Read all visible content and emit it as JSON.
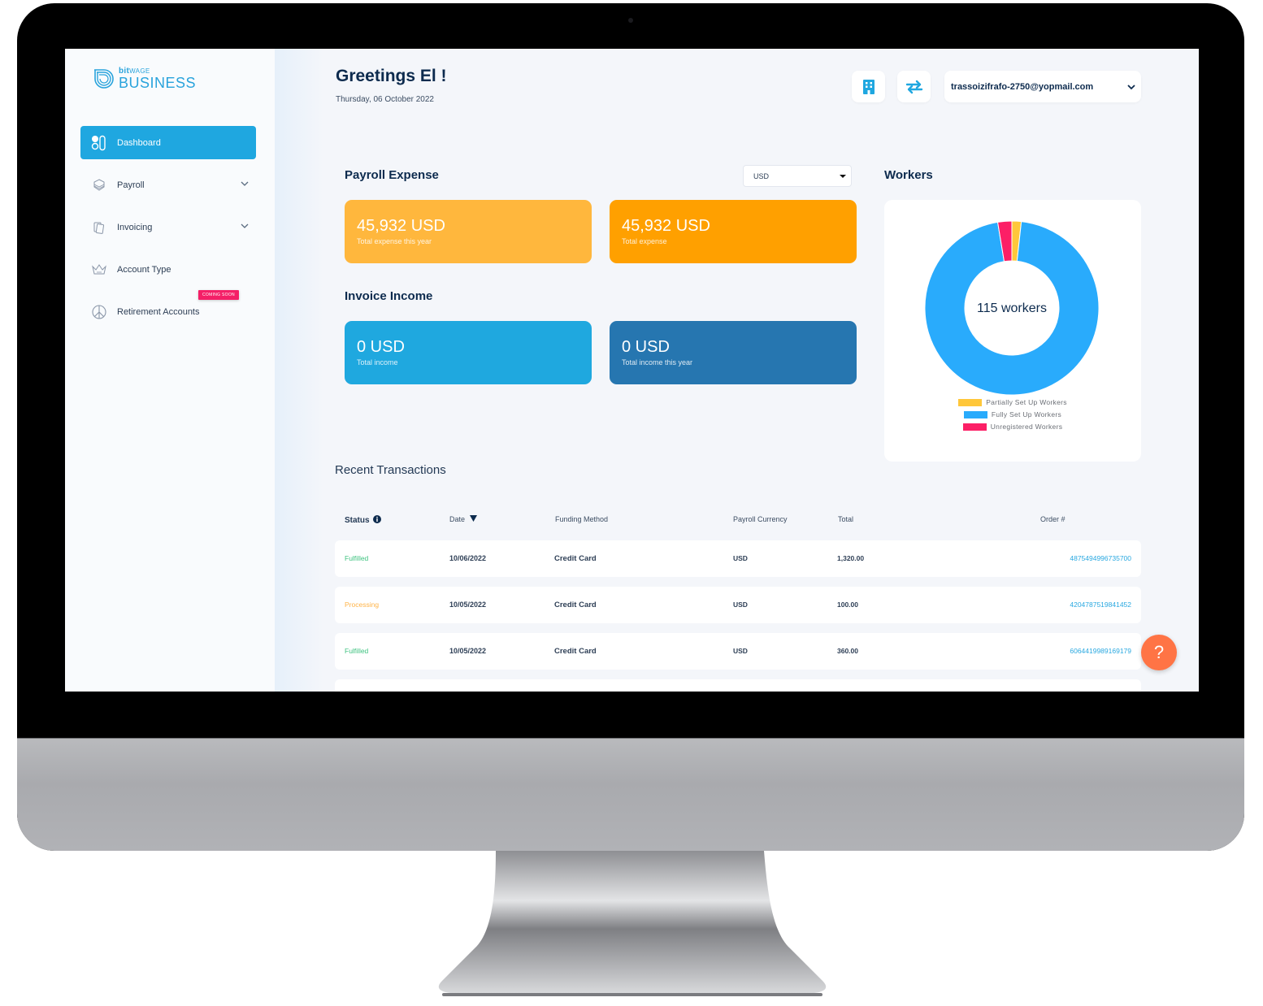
{
  "app": {
    "logo_small_bold": "bit",
    "logo_small_light": "WAGE",
    "logo_big": "BUSINESS"
  },
  "sidebar": {
    "items": [
      {
        "label": "Dashboard",
        "icon": "dashboard-icon",
        "active": true
      },
      {
        "label": "Payroll",
        "icon": "layers-icon",
        "expandable": true
      },
      {
        "label": "Invoicing",
        "icon": "invoice-icon",
        "expandable": true
      },
      {
        "label": "Account Type",
        "icon": "crown-icon"
      },
      {
        "label": "Retirement Accounts",
        "icon": "peace-icon",
        "badge": "COMING SOON"
      }
    ]
  },
  "header": {
    "greeting": "Greetings El !",
    "date": "Thursday, 06 October 2022",
    "buttons": [
      {
        "icon": "building-icon"
      },
      {
        "icon": "swap-arrows-icon"
      }
    ],
    "user_email": "trassoizifrafo-2750@yopmail.com"
  },
  "payroll": {
    "title": "Payroll Expense",
    "currency_select": "USD",
    "cards": [
      {
        "value": "45,932 USD",
        "label": "Total expense this year",
        "color": "#ffb73d"
      },
      {
        "value": "45,932 USD",
        "label": "Total expense",
        "color": "#ffa000"
      }
    ]
  },
  "invoice": {
    "title": "Invoice Income",
    "cards": [
      {
        "value": "0 USD",
        "label": "Total income",
        "color": "#1fa8df"
      },
      {
        "value": "0 USD",
        "label": "Total income this year",
        "color": "#2676b0"
      }
    ]
  },
  "workers": {
    "title": "Workers",
    "center_label": "115 workers",
    "legend": [
      {
        "label": "Partially Set Up Workers",
        "color": "#ffc73a"
      },
      {
        "label": "Fully Set Up Workers",
        "color": "#29abfc"
      },
      {
        "label": "Unregistered Workers",
        "color": "#fc1f66"
      }
    ]
  },
  "chart_data": {
    "type": "pie",
    "title": "Workers",
    "total_label": "115 workers",
    "categories": [
      "Partially Set Up Workers",
      "Fully Set Up Workers",
      "Unregistered Workers"
    ],
    "values": [
      2,
      110,
      3
    ],
    "colors": [
      "#ffc73a",
      "#29abfc",
      "#fc1f66"
    ],
    "legend": "bottom"
  },
  "transactions": {
    "title": "Recent Transactions",
    "columns": [
      "Status",
      "Date",
      "Funding Method",
      "Payroll Currency",
      "Total",
      "Order #"
    ],
    "rows": [
      {
        "status": "Fulfilled",
        "status_color": "#3fc380",
        "date": "10/06/2022",
        "method": "Credit Card",
        "currency": "USD",
        "total": "1,320.00",
        "order": "4875494996735700"
      },
      {
        "status": "Processing",
        "status_color": "#ffb347",
        "date": "10/05/2022",
        "method": "Credit Card",
        "currency": "USD",
        "total": "100.00",
        "order": "4204787519841452"
      },
      {
        "status": "Fulfilled",
        "status_color": "#3fc380",
        "date": "10/05/2022",
        "method": "Credit Card",
        "currency": "USD",
        "total": "360.00",
        "order": "6064419989169179"
      }
    ]
  },
  "help": {
    "label": "?"
  }
}
